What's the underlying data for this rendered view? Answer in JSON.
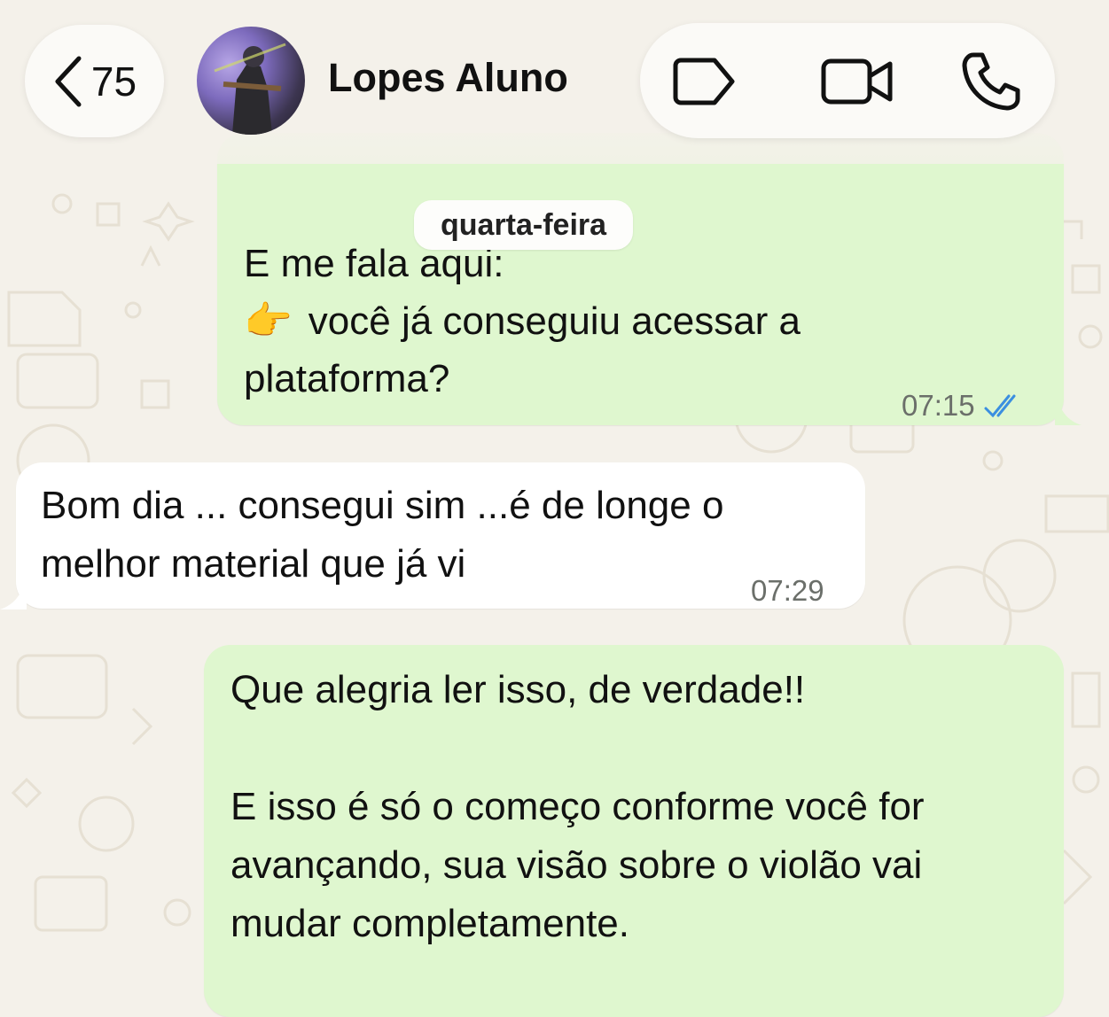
{
  "header": {
    "back_count": "75",
    "contact_name": "Lopes Aluno"
  },
  "date_chip": "quarta-feira",
  "messages": [
    {
      "direction": "outgoing",
      "lines": [
        "E me fala aqui:",
        "você já conseguiu acessar a",
        "plataforma?"
      ],
      "emoji": "👉",
      "time": "07:15",
      "status": "read"
    },
    {
      "direction": "incoming",
      "lines": [
        "Bom dia ... consegui sim ...é de longe o",
        "melhor material que já vi"
      ],
      "time": "07:29"
    },
    {
      "direction": "outgoing",
      "lines": [
        "Que alegria ler isso, de verdade!!",
        "E isso é só o começo conforme você for",
        "avançando, sua visão sobre o violão vai",
        "mudar completamente."
      ]
    }
  ],
  "colors": {
    "outgoing_bubble": "#dff7cf",
    "incoming_bubble": "#ffffff",
    "read_ticks": "#3b8fe0",
    "background": "#f4f1ea"
  },
  "icons": [
    "chevron-left-icon",
    "tag-icon",
    "video-camera-icon",
    "phone-icon",
    "double-check-icon"
  ]
}
